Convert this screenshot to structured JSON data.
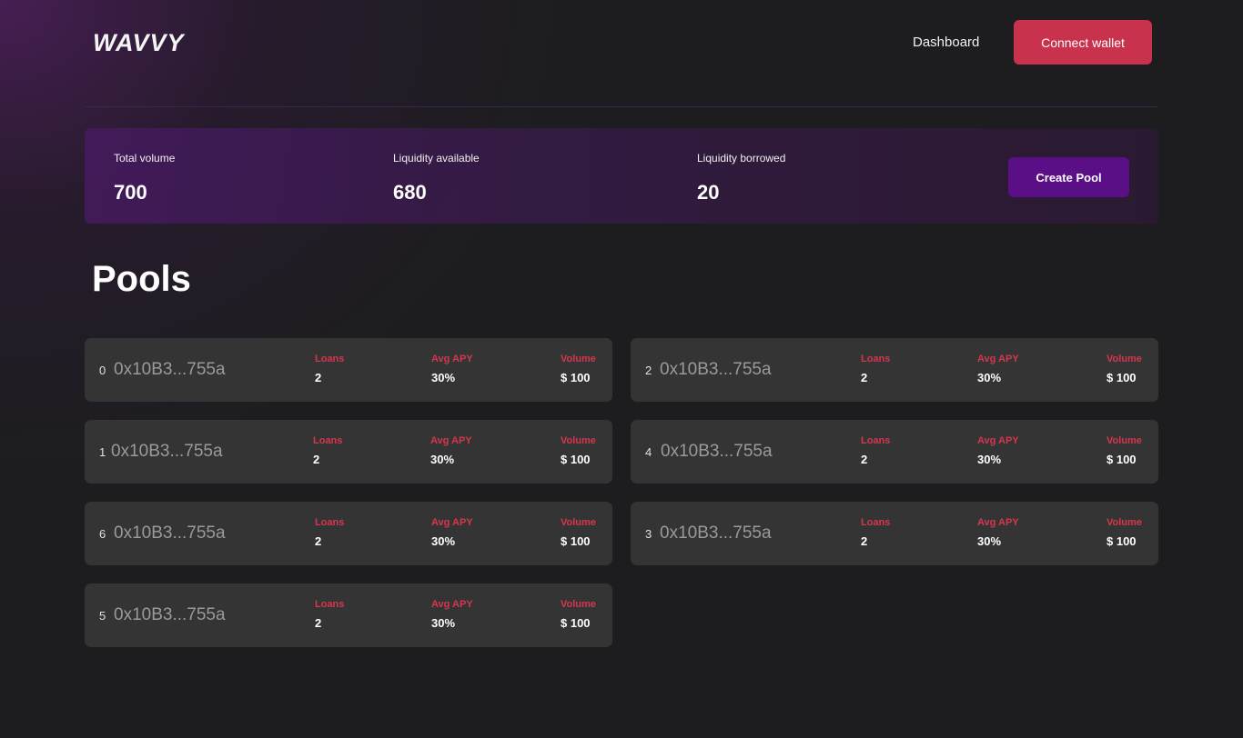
{
  "header": {
    "logo_text": "WAVVY",
    "nav_dashboard": "Dashboard",
    "connect_wallet": "Connect wallet"
  },
  "stats": {
    "total_volume_label": "Total volume",
    "total_volume_value": "700",
    "liquidity_available_label": "Liquidity available",
    "liquidity_available_value": "680",
    "liquidity_borrowed_label": "Liquidity borrowed",
    "liquidity_borrowed_value": "20",
    "create_pool": "Create Pool"
  },
  "pools_title": "Pools",
  "column_labels": {
    "loans": "Loans",
    "avg_apy": "Avg APY",
    "volume": "Volume"
  },
  "pools": [
    {
      "index": "0",
      "address": "0x10B3...755a",
      "loans": "2",
      "avg_apy": "30%",
      "volume": "$ 100"
    },
    {
      "index": "2",
      "address": "0x10B3...755a",
      "loans": "2",
      "avg_apy": "30%",
      "volume": "$ 100"
    },
    {
      "index": "1",
      "address": "0x10B3...755a",
      "loans": "2",
      "avg_apy": "30%",
      "volume": "$ 100"
    },
    {
      "index": "4",
      "address": "0x10B3...755a",
      "loans": "2",
      "avg_apy": "30%",
      "volume": "$ 100"
    },
    {
      "index": "6",
      "address": "0x10B3...755a",
      "loans": "2",
      "avg_apy": "30%",
      "volume": "$ 100"
    },
    {
      "index": "3",
      "address": "0x10B3...755a",
      "loans": "2",
      "avg_apy": "30%",
      "volume": "$ 100"
    },
    {
      "index": "5",
      "address": "0x10B3...755a",
      "loans": "2",
      "avg_apy": "30%",
      "volume": "$ 100"
    }
  ],
  "colors": {
    "background": "#1d1d1f",
    "accent_red": "#c9324d",
    "accent_purple": "#5a0f86",
    "card": "#343434",
    "label_red": "#d4374e"
  }
}
